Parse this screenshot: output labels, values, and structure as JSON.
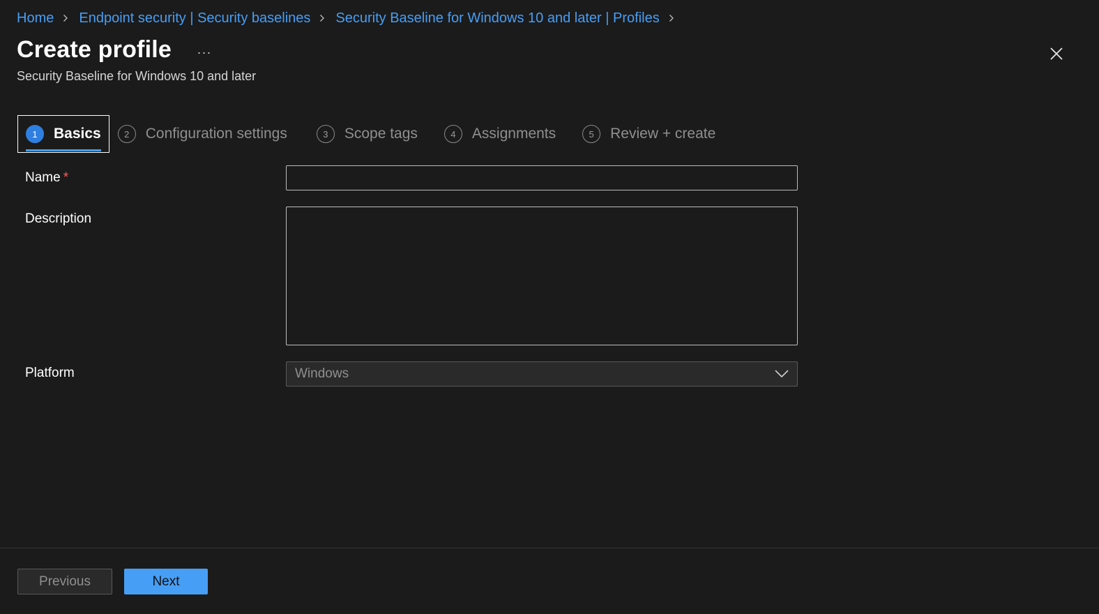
{
  "breadcrumb": [
    {
      "label": "Home"
    },
    {
      "label": "Endpoint security | Security baselines"
    },
    {
      "label": "Security Baseline for Windows 10 and later | Profiles"
    }
  ],
  "header": {
    "title": "Create profile",
    "more": "···",
    "subtitle": "Security Baseline for Windows 10 and later"
  },
  "steps": [
    {
      "number": "1",
      "label": "Basics",
      "active": true
    },
    {
      "number": "2",
      "label": "Configuration settings",
      "active": false
    },
    {
      "number": "3",
      "label": "Scope tags",
      "active": false
    },
    {
      "number": "4",
      "label": "Assignments",
      "active": false
    },
    {
      "number": "5",
      "label": "Review + create",
      "active": false
    }
  ],
  "form": {
    "name_label": "Name",
    "required_mark": "*",
    "name_value": "",
    "description_label": "Description",
    "description_value": "",
    "platform_label": "Platform",
    "platform_value": "Windows"
  },
  "footer": {
    "previous_label": "Previous",
    "next_label": "Next"
  },
  "colors": {
    "background": "#1b1b1b",
    "link": "#479ef5",
    "accent": "#479ef5",
    "required": "#ff5a5a"
  },
  "icons": {
    "breadcrumb_separator": "chevron-right-icon",
    "close": "close-icon",
    "more": "more-icon",
    "dropdown": "chevron-down-icon"
  }
}
